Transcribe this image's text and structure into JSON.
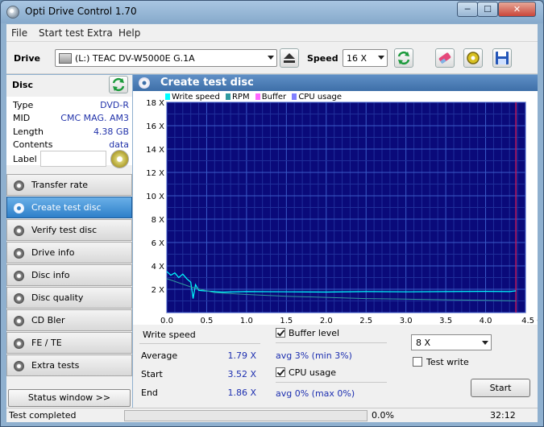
{
  "window": {
    "title": "Opti Drive Control 1.70",
    "min_label": "─",
    "max_label": "☐",
    "close_label": "✕"
  },
  "menu": [
    "File",
    "Start test",
    "Extra",
    "Help"
  ],
  "toolbar": {
    "drive_label": "Drive",
    "drive_value": "(L:)   TEAC DV-W5000E G.1A",
    "speed_label": "Speed",
    "speed_value": "16 X"
  },
  "disc": {
    "title": "Disc",
    "props": [
      {
        "k": "Type",
        "v": "DVD-R"
      },
      {
        "k": "MID",
        "v": "CMC MAG. AM3"
      },
      {
        "k": "Length",
        "v": "4.38 GB"
      },
      {
        "k": "Contents",
        "v": "data"
      }
    ],
    "label_label": "Label"
  },
  "nav": [
    "Transfer rate",
    "Create test disc",
    "Verify test disc",
    "Drive info",
    "Disc info",
    "Disc quality",
    "CD Bler",
    "FE / TE",
    "Extra tests"
  ],
  "nav_active": 1,
  "status_window_btn": "Status window >>",
  "panel": {
    "title": "Create test disc"
  },
  "chart_data": {
    "type": "line",
    "legend": [
      "Write speed",
      "RPM",
      "Buffer",
      "CPU usage"
    ],
    "legend_colors": [
      "#00ffff",
      "#2f9aa0",
      "#ff66ff",
      "#8080ff"
    ],
    "x_ticks": [
      "0.0",
      "0.5",
      "1.0",
      "1.5",
      "2.0",
      "2.5",
      "3.0",
      "3.5",
      "4.0",
      "4.5 GB"
    ],
    "y_ticks": [
      "2 X",
      "4 X",
      "6 X",
      "8 X",
      "10 X",
      "12 X",
      "14 X",
      "16 X",
      "18 X"
    ],
    "xlim": [
      0,
      4.5
    ],
    "ylim": [
      0,
      18
    ],
    "disc_end_gb": 4.38,
    "series": [
      {
        "name": "Write speed",
        "color": "#00ffff",
        "x": [
          0,
          0.05,
          0.1,
          0.15,
          0.2,
          0.25,
          0.3,
          0.33,
          0.36,
          0.4,
          0.5,
          0.7,
          1.0,
          1.5,
          2.0,
          2.5,
          3.0,
          3.5,
          4.0,
          4.3,
          4.38
        ],
        "y": [
          3.52,
          3.2,
          3.4,
          3.0,
          3.3,
          2.9,
          2.6,
          1.2,
          2.4,
          1.9,
          1.85,
          1.75,
          1.8,
          1.78,
          1.76,
          1.8,
          1.78,
          1.8,
          1.82,
          1.8,
          1.86
        ]
      },
      {
        "name": "RPM",
        "color": "#2f9aa0",
        "x": [
          0,
          0.3,
          0.6,
          1.0,
          1.5,
          2.0,
          2.5,
          3.0,
          3.5,
          4.0,
          4.38
        ],
        "y": [
          2.9,
          2.2,
          1.7,
          1.55,
          1.4,
          1.3,
          1.2,
          1.15,
          1.1,
          1.05,
          1.0
        ]
      }
    ]
  },
  "stats": {
    "write_speed_label": "Write speed",
    "average_label": "Average",
    "average_value": "1.79 X",
    "start_label": "Start",
    "start_value": "3.52 X",
    "end_label": "End",
    "end_value": "1.86 X",
    "buffer_label": "Buffer level",
    "buffer_value": "avg 3% (min 3%)",
    "cpu_label": "CPU usage",
    "cpu_value": "avg 0% (max 0%)",
    "write_speed_select": "8 X",
    "test_write_label": "Test write",
    "start_button": "Start"
  },
  "statusbar": {
    "text": "Test completed",
    "percent": "0.0%",
    "time": "32:12",
    "progress": 0
  }
}
